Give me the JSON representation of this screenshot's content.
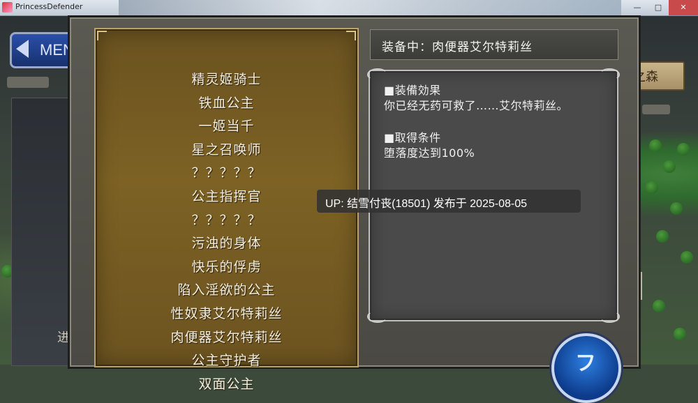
{
  "window": {
    "title": "PrincessDefender"
  },
  "background": {
    "menu_label": "MEN",
    "forest_sign": "之森",
    "left_char": "进"
  },
  "titles_list": [
    "精灵姬骑士",
    "铁血公主",
    "一姬当千",
    "星之召唤师",
    "？？？？？",
    "公主指挥官",
    "？？？？？",
    "污浊的身体",
    "快乐的俘虏",
    "陷入淫欲的公主",
    "性奴隶艾尔特莉丝",
    "肉便器艾尔特莉丝",
    "公主守护者",
    "双面公主"
  ],
  "equip": {
    "label": "装备中：肉便器艾尔特莉丝"
  },
  "detail": {
    "effect_heading": "■装備効果",
    "effect_text": "你已经无药可救了……艾尔特莉丝。",
    "condition_heading": "■取得条件",
    "condition_text": "堕落度达到100%"
  },
  "overlay": {
    "text": "UP: 结雪付丧(18501) 发布于 2025-08-05"
  },
  "round_button": {
    "glyph": "フ"
  },
  "colors": {
    "list_panel": "#7d6224",
    "detail_panel": "#4a4a4a",
    "frame": "#5a5952"
  }
}
